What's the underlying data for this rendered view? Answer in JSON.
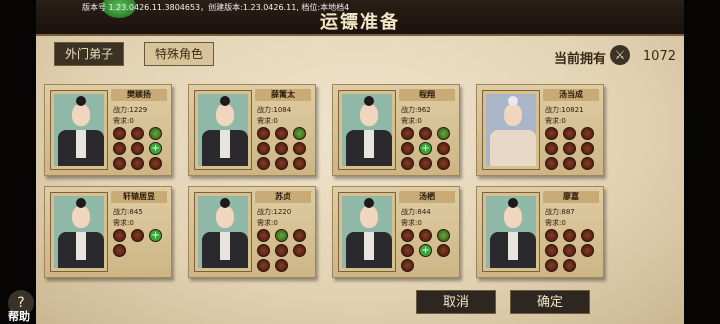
{
  "version_text": "版本号 1.23.0426.11.3804653，创建版本:1.23.0426.11, 档位:本地档4",
  "title": "运镖准备",
  "tabs": [
    "外门弟子",
    "特殊角色"
  ],
  "owned": {
    "label": "当前拥有",
    "value": "1072",
    "icon": "crossed-swords-icon"
  },
  "power_label": "战力:",
  "need_label": "需求:",
  "cards": [
    {
      "name": "樊颖扬",
      "power": "1229",
      "need": "0"
    },
    {
      "name": "薛篱太",
      "power": "1084",
      "need": "0"
    },
    {
      "name": "程翔",
      "power": "962",
      "need": "0"
    },
    {
      "name": "汤当成",
      "power": "10821",
      "need": "0"
    },
    {
      "name": "轩辕居昱",
      "power": "845",
      "need": "0"
    },
    {
      "name": "苏贞",
      "power": "1220",
      "need": "0"
    },
    {
      "name": "汤栖",
      "power": "844",
      "need": "0"
    },
    {
      "name": "廖嘉",
      "power": "887",
      "need": "0"
    }
  ],
  "help_label": "帮助",
  "cancel_label": "取消",
  "confirm_label": "确定"
}
